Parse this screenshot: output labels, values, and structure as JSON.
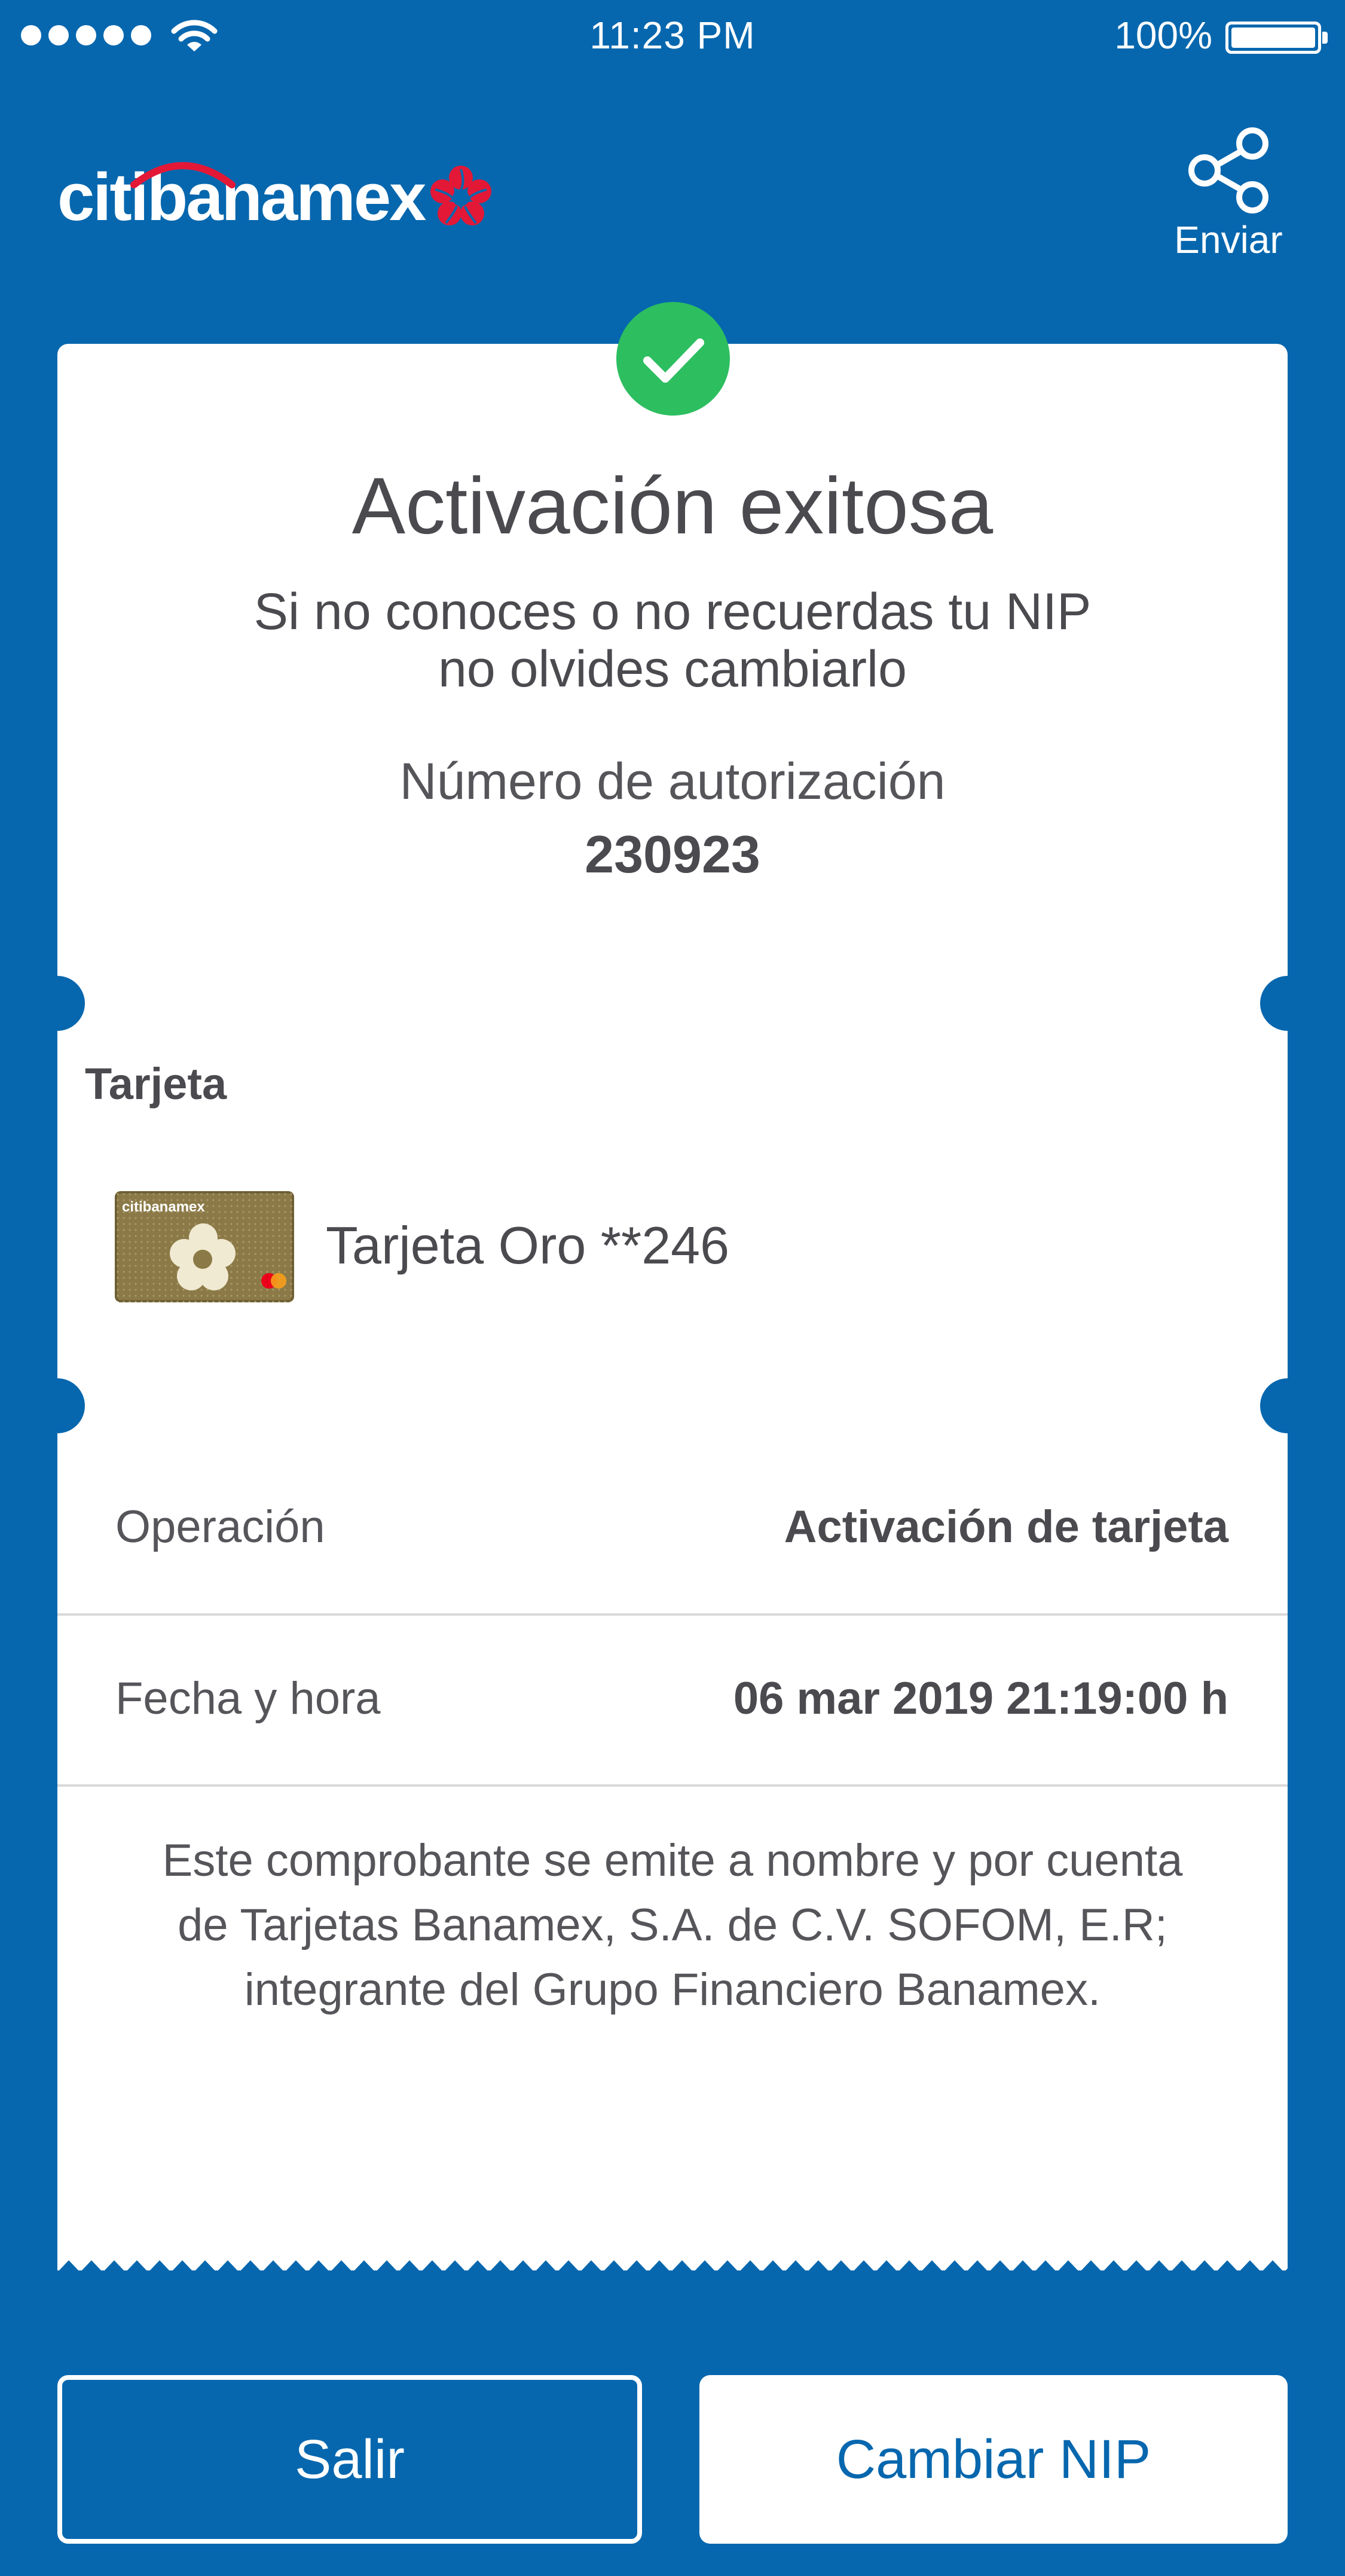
{
  "status_bar": {
    "time": "11:23 PM",
    "battery": "100%"
  },
  "header": {
    "logo_text": "citibanamex",
    "share_label": "Enviar"
  },
  "receipt": {
    "title": "Activación exitosa",
    "subtitle_line1": "Si no conoces o no recuerdas tu NIP",
    "subtitle_line2": "no olvides cambiarlo",
    "auth_label": "Número de autorización",
    "auth_number": "230923",
    "card_section_label": "Tarjeta",
    "card_name": "Tarjeta Oro **246",
    "card_thumb_brand": "citibanamex",
    "details": [
      {
        "label": "Operación",
        "value": "Activación de tarjeta"
      },
      {
        "label": "Fecha y hora",
        "value": "06 mar 2019 21:19:00 h"
      }
    ],
    "disclaimer_line1": "Este comprobante se emite a nombre y por cuenta",
    "disclaimer_line2": "de Tarjetas Banamex, S.A. de C.V. SOFOM, E.R;",
    "disclaimer_line3": "integrante del Grupo Financiero Banamex."
  },
  "buttons": {
    "exit_label": "Salir",
    "change_pin_label": "Cambiar NIP"
  },
  "colors": {
    "background": "#0667ae",
    "success": "#2dbe60",
    "logo_red": "#e31837",
    "text": "#4a4a4f"
  }
}
